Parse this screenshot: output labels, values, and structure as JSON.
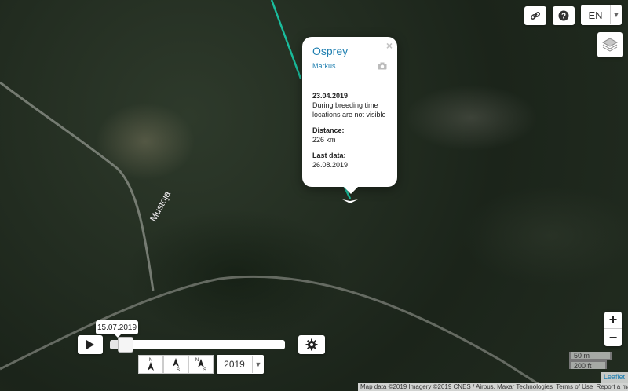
{
  "map": {
    "road_label": "Mustoja",
    "track_color": "#1abc9c"
  },
  "top_controls": {
    "link_icon": "link-icon",
    "help_icon": "question-circle-icon",
    "language": "EN",
    "layers_icon": "layers-icon"
  },
  "popup": {
    "title": "Osprey",
    "author": "Markus",
    "date": "23.04.2019",
    "note": "During breeding time locations are not visible",
    "distance_label": "Distance:",
    "distance_value": "226 km",
    "last_data_label": "Last data:",
    "last_data_value": "26.08.2019",
    "close": "×"
  },
  "timeline": {
    "date_label": "15.07.2019",
    "progress": 0.05,
    "year": "2019",
    "direction_filters": [
      {
        "name": "north-arrow",
        "label": "N"
      },
      {
        "name": "north-south-arrow",
        "label": "S"
      },
      {
        "name": "north-south-both",
        "label": "NS"
      }
    ]
  },
  "zoom": {
    "in": "+",
    "out": "−"
  },
  "scale": {
    "metric": "50 m",
    "imperial": "200 ft"
  },
  "leaflet": "Leaflet",
  "attribution": {
    "data": "Map data ©2019 Imagery ©2019 CNES / Airbus, Maxar Technologies",
    "terms": "Terms of Use",
    "report": "Report a map error"
  }
}
